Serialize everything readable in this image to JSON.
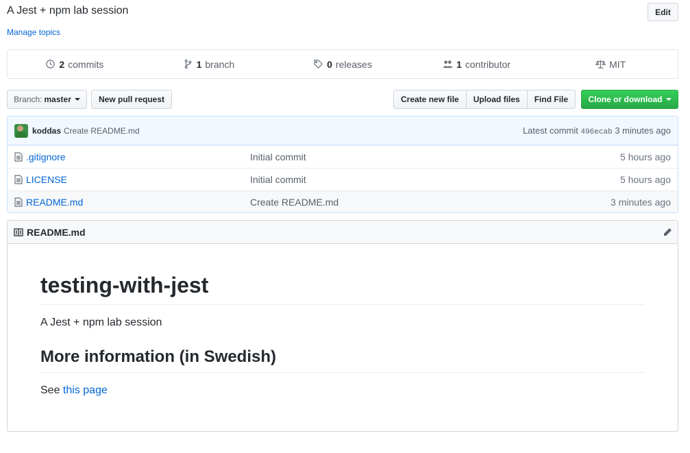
{
  "repo": {
    "description": "A Jest + npm lab session",
    "manage_topics": "Manage topics",
    "edit_label": "Edit"
  },
  "summary": [
    {
      "icon": "history-icon",
      "count": "2",
      "label": "commits"
    },
    {
      "icon": "branch-icon",
      "count": "1",
      "label": "branch"
    },
    {
      "icon": "tag-icon",
      "count": "0",
      "label": "releases"
    },
    {
      "icon": "people-icon",
      "count": "1",
      "label": "contributor"
    },
    {
      "icon": "law-icon",
      "count": "",
      "label": "MIT"
    }
  ],
  "toolbar": {
    "branch_label": "Branch:",
    "branch_value": "master",
    "new_pull_request": "New pull request",
    "create_new_file": "Create new file",
    "upload_files": "Upload files",
    "find_file": "Find File",
    "clone_or_download": "Clone or download"
  },
  "latest_commit": {
    "author": "koddas",
    "message": "Create README.md",
    "prefix": "Latest commit",
    "sha": "496ecab",
    "age": "3 minutes ago"
  },
  "files": [
    {
      "name": ".gitignore",
      "message": "Initial commit",
      "age": "5 hours ago"
    },
    {
      "name": "LICENSE",
      "message": "Initial commit",
      "age": "5 hours ago"
    },
    {
      "name": "README.md",
      "message": "Create README.md",
      "age": "3 minutes ago"
    }
  ],
  "readme": {
    "filename": "README.md",
    "title": "testing-with-jest",
    "intro": "A Jest + npm lab session",
    "heading2": "More information (in Swedish)",
    "see_prefix": "See",
    "link_text": "this page"
  },
  "colors": {
    "link": "#0366d6",
    "clone_button": "#28a745",
    "commit_bar": "#f1f8ff"
  }
}
